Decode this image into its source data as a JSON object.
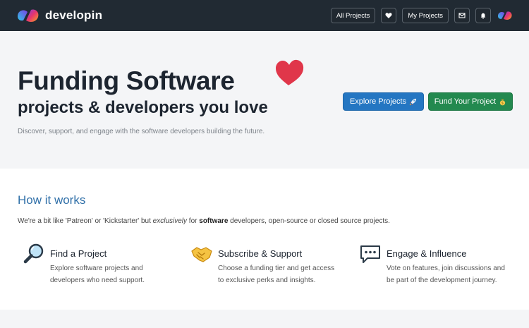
{
  "navbar": {
    "brand_name": "developin",
    "all_projects_label": "All Projects",
    "my_projects_label": "My Projects"
  },
  "hero": {
    "title": "Funding Software",
    "subtitle": "projects & developers you love",
    "description": "Discover, support, and engage with the software developers building the future.",
    "explore_label": "Explore Projects",
    "fund_label": "Fund Your Project"
  },
  "how_it_works": {
    "title": "How it works",
    "intro_part1": "We're a bit like 'Patreon' or 'Kickstarter' but ",
    "intro_em": "exclusively",
    "intro_part2": " for ",
    "intro_strong": "software",
    "intro_part3": " developers, open-source or closed source projects.",
    "features": [
      {
        "icon": "magnifier-icon",
        "title": "Find a Project",
        "desc": "Explore software projects and developers who need support."
      },
      {
        "icon": "handshake-icon",
        "title": "Subscribe & Support",
        "desc": "Choose a funding tier and get access to exclusive perks and insights."
      },
      {
        "icon": "speech-bubble-icon",
        "title": "Engage & Influence",
        "desc": "Vote on features, join discussions and be part of the development journey."
      }
    ]
  },
  "colors": {
    "navbar_bg": "#212a33",
    "explore_blue": "#2476c2",
    "fund_green": "#23894f",
    "heart_red": "#e0364a",
    "heading_blue": "#2f6fa8"
  }
}
